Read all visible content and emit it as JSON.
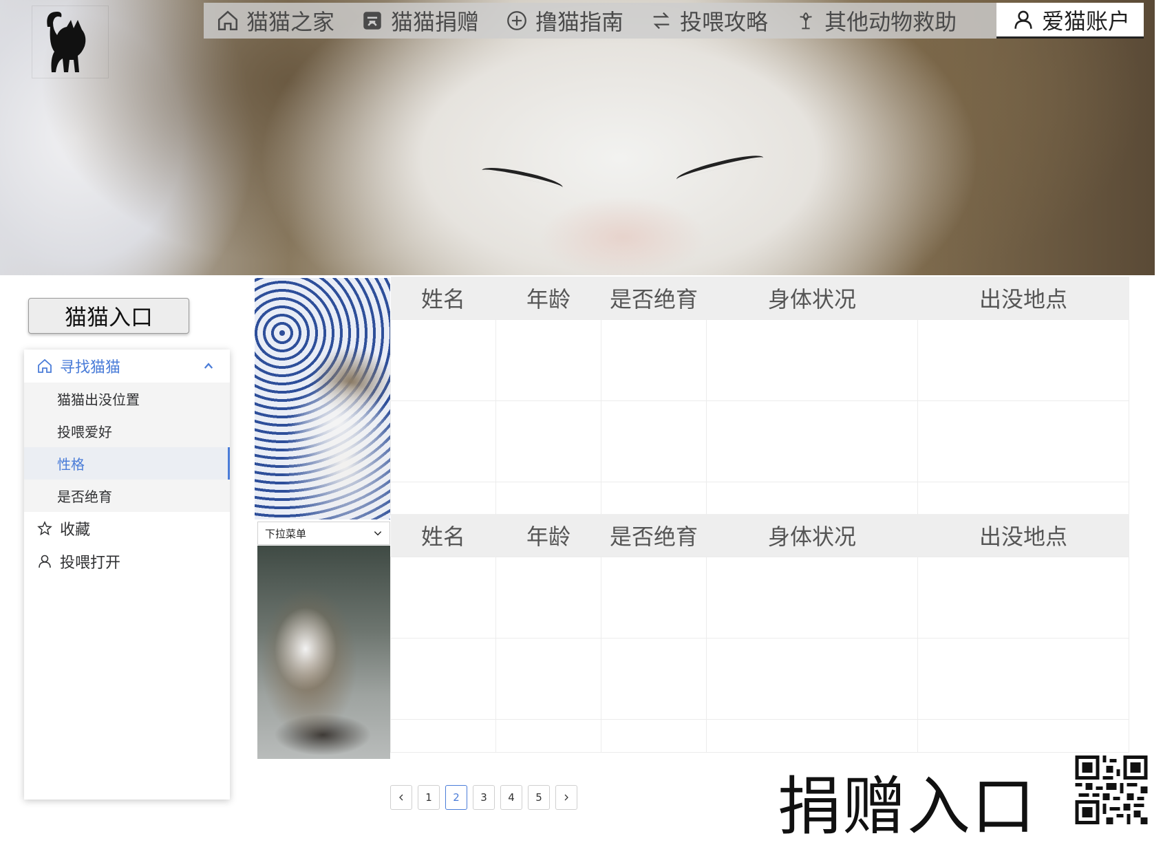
{
  "nav": {
    "items": [
      {
        "label": "猫猫之家",
        "icon": "home-icon"
      },
      {
        "label": "猫猫捐赠",
        "icon": "donate-icon"
      },
      {
        "label": "撸猫指南",
        "icon": "plus-circle-icon"
      },
      {
        "label": "投喂攻略",
        "icon": "swap-icon"
      },
      {
        "label": "其他动物救助",
        "icon": "flower-icon"
      }
    ],
    "account": {
      "label": "爱猫账户",
      "icon": "user-icon"
    }
  },
  "sidebar": {
    "entry_button": "猫猫入口",
    "group": {
      "label": "寻找猫猫",
      "icon": "home-icon",
      "expanded": true
    },
    "sub_items": [
      "猫猫出没位置",
      "投喂爱好",
      "性格",
      "是否绝育"
    ],
    "selected_sub_item": "性格",
    "items": [
      {
        "label": "收藏",
        "icon": "star-icon"
      },
      {
        "label": "投喂打开",
        "icon": "user-icon"
      }
    ]
  },
  "dropdown": {
    "label": "下拉菜单"
  },
  "tables": {
    "headers": [
      "姓名",
      "年龄",
      "是否绝育",
      "身体状况",
      "出没地点"
    ]
  },
  "pagination": {
    "pages": [
      "1",
      "2",
      "3",
      "4",
      "5"
    ],
    "current": "2"
  },
  "donate": {
    "label": "捐赠入口"
  },
  "colors": {
    "accent": "#4a7cd8",
    "nav_bg": "#cdcdcd",
    "header_bg": "#eeeeee"
  }
}
